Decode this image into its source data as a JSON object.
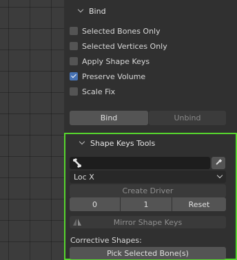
{
  "bind_panel": {
    "title": "Bind",
    "options": [
      {
        "label": "Selected Bones Only",
        "checked": false
      },
      {
        "label": "Selected Vertices Only",
        "checked": false
      },
      {
        "label": "Apply Shape Keys",
        "checked": false
      },
      {
        "label": "Preserve Volume",
        "checked": true
      },
      {
        "label": "Scale Fix",
        "checked": false
      }
    ],
    "bind_label": "Bind",
    "unbind_label": "Unbind"
  },
  "shape_keys_tools": {
    "title": "Shape Keys Tools",
    "bone_field_value": "",
    "transform_select": "Loc X",
    "create_driver_label": "Create Driver",
    "min_value": "0",
    "max_value": "1",
    "reset_label": "Reset",
    "mirror_label": "Mirror Shape Keys",
    "corrective_label": "Corrective Shapes:",
    "pick_selected_label": "Pick Selected Bone(s)"
  },
  "colors": {
    "highlight_border": "#57d72e",
    "checkbox_on": "#4772b3",
    "panel_bg": "#303030"
  },
  "icons": [
    "chevron-down-icon",
    "bone-icon",
    "eyedropper-icon",
    "mirror-icon",
    "checkmark-icon"
  ]
}
